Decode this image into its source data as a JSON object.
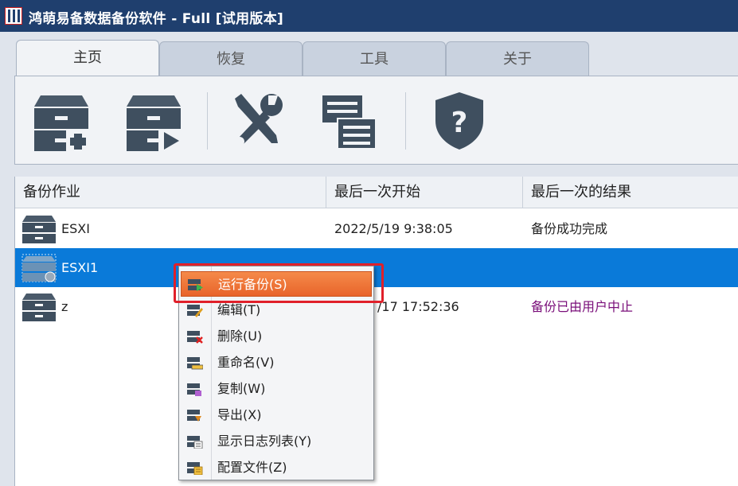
{
  "window": {
    "title": "鸿萌易备数据备份软件 - Full [试用版本]"
  },
  "tabs": [
    {
      "label": "主页",
      "active": true
    },
    {
      "label": "恢复",
      "active": false
    },
    {
      "label": "工具",
      "active": false
    },
    {
      "label": "关于",
      "active": false
    }
  ],
  "toolbar": {
    "icons": [
      "add-backup-job-icon",
      "run-backup-icon",
      "tools-icon",
      "logs-icon",
      "help-shield-icon"
    ]
  },
  "list": {
    "headers": [
      "备份作业",
      "最后一次开始",
      "最后一次的结果"
    ],
    "rows": [
      {
        "name": "ESXI",
        "last_start": "2022/5/19 9:38:05",
        "result": "备份成功完成",
        "selected": false
      },
      {
        "name": "ESXI1",
        "last_start": "",
        "result": "",
        "selected": true
      },
      {
        "name": "z",
        "last_start": "/17 17:52:36",
        "result": "备份已由用户中止",
        "selected": false
      }
    ]
  },
  "context_menu": {
    "items": [
      {
        "label": "运行备份(S)",
        "icon": "run-backup-icon",
        "highlighted": true
      },
      {
        "label": "编辑(T)",
        "icon": "edit-icon"
      },
      {
        "label": "删除(U)",
        "icon": "delete-icon"
      },
      {
        "label": "重命名(V)",
        "icon": "rename-icon"
      },
      {
        "label": "复制(W)",
        "icon": "copy-icon"
      },
      {
        "label": "导出(X)",
        "icon": "export-icon"
      },
      {
        "label": "显示日志列表(Y)",
        "icon": "log-list-icon"
      },
      {
        "label": "配置文件(Z)",
        "icon": "config-file-icon"
      }
    ]
  },
  "colors": {
    "titlebar": "#1f3f6e",
    "selection": "#0a7ad9",
    "menu_highlight": "#ee7436",
    "annotation_box": "#e0202a",
    "aborted_status": "#7a0f7a"
  }
}
